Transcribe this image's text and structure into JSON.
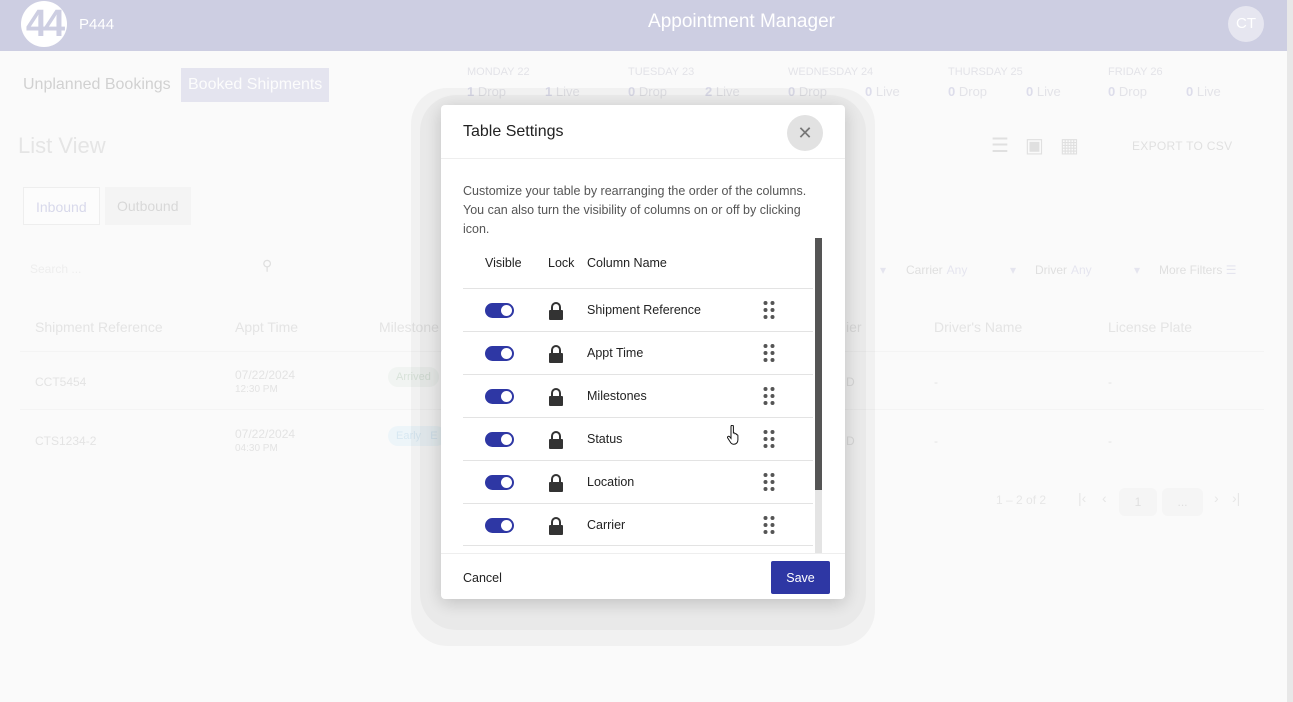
{
  "header": {
    "logo_text": "44",
    "client_code": "P444",
    "app_title": "Appointment Manager",
    "avatar_initials": "CT",
    "bg_color": "#cdcee2"
  },
  "booking_tabs": [
    {
      "label": "Unplanned Bookings",
      "active": false
    },
    {
      "label": "Booked Shipments",
      "active": true
    }
  ],
  "calendar": [
    {
      "day": "MONDAY 22",
      "drop_count": "1",
      "drop_label": "Drop",
      "live_count": "1",
      "live_label": "Live"
    },
    {
      "day": "TUESDAY 23",
      "drop_count": "0",
      "drop_label": "Drop",
      "live_count": "2",
      "live_label": "Live"
    },
    {
      "day": "WEDNESDAY 24",
      "drop_count": "0",
      "drop_label": "Drop",
      "live_count": "0",
      "live_label": "Live"
    },
    {
      "day": "THURSDAY 25",
      "drop_count": "0",
      "drop_label": "Drop",
      "live_count": "0",
      "live_label": "Live"
    },
    {
      "day": "FRIDAY 26",
      "drop_count": "0",
      "drop_label": "Drop",
      "live_count": "0",
      "live_label": "Live"
    }
  ],
  "list_title": "List View",
  "export_label": "EXPORT TO CSV",
  "direction_tabs": [
    {
      "label": "Inbound",
      "active": true
    },
    {
      "label": "Outbound",
      "active": false
    }
  ],
  "search": {
    "placeholder": "Search ..."
  },
  "filters": [
    {
      "label": "Carrier",
      "value": "Any"
    },
    {
      "label": "Driver",
      "value": "Any"
    },
    {
      "label": "More Filters",
      "value": ""
    }
  ],
  "table": {
    "headers": [
      "Shipment Reference",
      "Appt Time",
      "Milestone",
      "ier",
      "Driver's Name",
      "License Plate"
    ],
    "rows": [
      {
        "ref": "CCT5454",
        "date": "07/22/2024",
        "time": "12:30 PM",
        "milestone": "Arrived",
        "carrier": "D",
        "driver": "-",
        "plate": "-"
      },
      {
        "ref": "CTS1234-2",
        "date": "07/22/2024",
        "time": "04:30 PM",
        "milestone": "Early",
        "milestone2": "E",
        "carrier": "D",
        "driver": "-",
        "plate": "-"
      }
    ]
  },
  "pagination": {
    "summary": "1 – 2 of 2",
    "page": "1",
    "page_size": "..."
  },
  "modal": {
    "title": "Table Settings",
    "description": "Customize your table by rearranging the order of the columns. You can also turn the visibility of columns on or off by clicking icon.",
    "col_visible": "Visible",
    "col_lock": "Lock",
    "col_name": "Column Name",
    "rows": [
      {
        "name": "Shipment Reference",
        "visible": true,
        "locked": true
      },
      {
        "name": "Appt Time",
        "visible": true,
        "locked": true
      },
      {
        "name": "Milestones",
        "visible": true,
        "locked": true
      },
      {
        "name": "Status",
        "visible": true,
        "locked": true
      },
      {
        "name": "Location",
        "visible": true,
        "locked": true
      },
      {
        "name": "Carrier",
        "visible": true,
        "locked": true
      }
    ],
    "cancel_label": "Cancel",
    "save_label": "Save",
    "accent": "#2e37a4"
  }
}
